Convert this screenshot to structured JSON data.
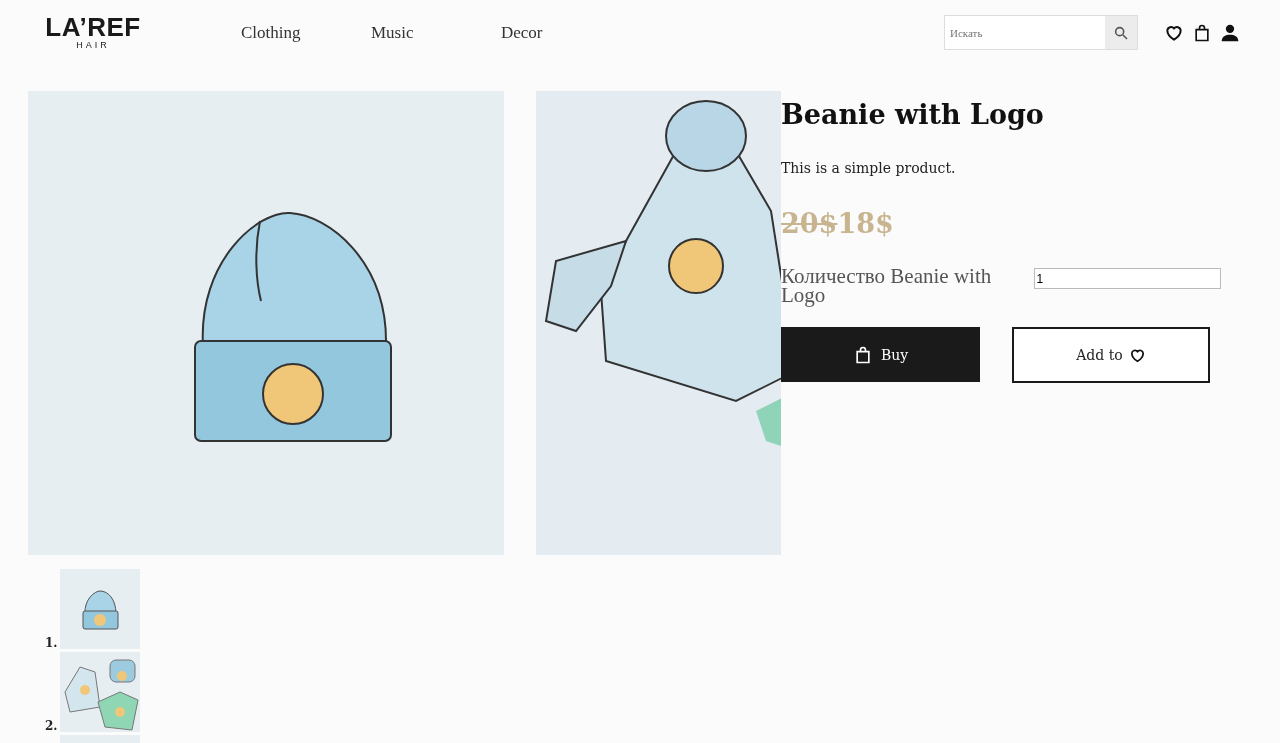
{
  "header": {
    "logo": {
      "name": "LA’REF",
      "sub": "HAIR"
    },
    "nav": [
      {
        "label": "Clothing"
      },
      {
        "label": "Music"
      },
      {
        "label": "Decor"
      }
    ],
    "search": {
      "placeholder": "Искать"
    }
  },
  "gallery": [
    {
      "kind": "picture"
    },
    {
      "kind": "picture"
    }
  ],
  "product": {
    "title": "Beanie with Logo",
    "description": "This is a simple product.",
    "old_price": "20$",
    "price": "18$",
    "quantity": {
      "label": "Количество Beanie with Logo",
      "value": "1"
    },
    "buy_button": "Buy",
    "wishlist_button": "Add to"
  },
  "thumbnails": [
    {
      "number": "1.",
      "kind": "picture"
    },
    {
      "number": "2.",
      "kind": "picture"
    },
    {
      "kind": "picture"
    }
  ]
}
